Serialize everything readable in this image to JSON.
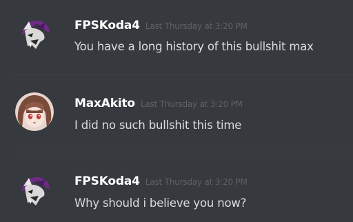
{
  "messages": [
    {
      "author": "FPSKoda4",
      "timestamp": "Last Thursday at 3:20 PM",
      "text": "You have a long history of this bullshit max",
      "avatar_icon": "wolf-avatar-icon"
    },
    {
      "author": "MaxAkito",
      "timestamp": "Last Thursday at 3:20 PM",
      "text": "I did no such bullshit this time",
      "avatar_icon": "anime-girl-avatar-icon"
    },
    {
      "author": "FPSKoda4",
      "timestamp": "Last Thursday at 3:20 PM",
      "text": "Why should i believe you now?",
      "avatar_icon": "wolf-avatar-icon"
    }
  ],
  "colors": {
    "background": "#36393e",
    "username": "#ffffff",
    "timestamp": "#5f6166",
    "message_text": "#dcddde",
    "divider": "#3e4147"
  }
}
